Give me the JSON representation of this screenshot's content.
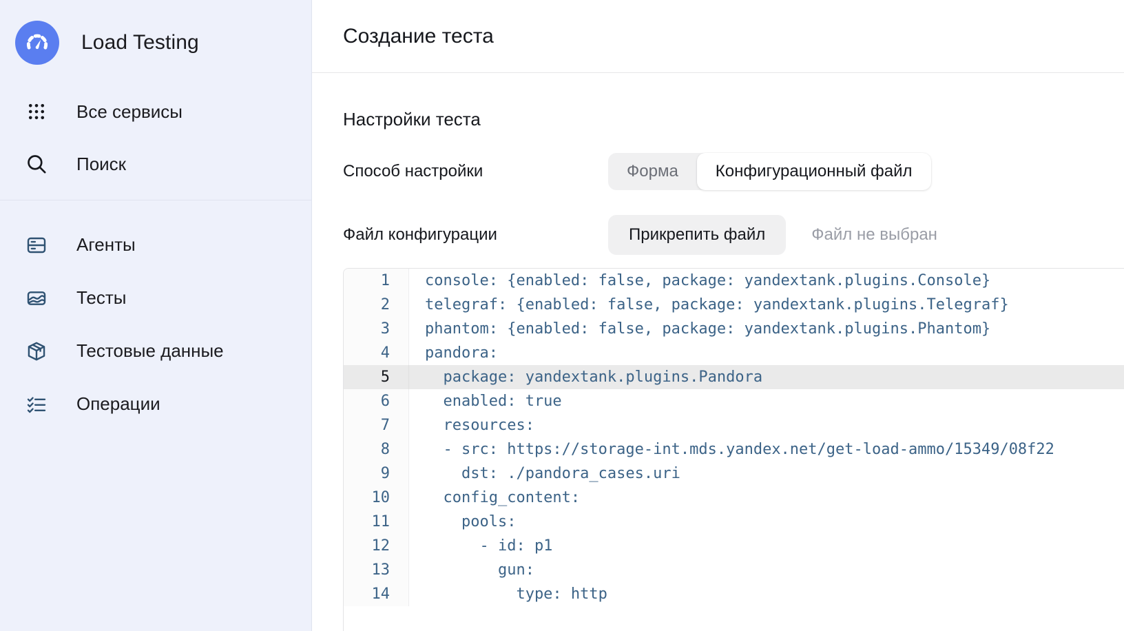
{
  "sidebar": {
    "brand": {
      "title": "Load Testing",
      "logo_icon": "speedometer-icon",
      "logo_color": "#5a7ef0"
    },
    "top_items": [
      {
        "label": "Все сервисы",
        "icon": "grid-dots-icon"
      },
      {
        "label": "Поиск",
        "icon": "search-icon"
      }
    ],
    "bottom_items": [
      {
        "label": "Агенты",
        "icon": "server-icon"
      },
      {
        "label": "Тесты",
        "icon": "chart-area-icon"
      },
      {
        "label": "Тестовые данные",
        "icon": "box-icon"
      },
      {
        "label": "Операции",
        "icon": "checklist-icon"
      }
    ]
  },
  "header": {
    "title": "Создание теста"
  },
  "main": {
    "section_title": "Настройки теста",
    "config_method": {
      "label": "Способ настройки",
      "options": [
        "Форма",
        "Конфигурационный файл"
      ],
      "selected": "Конфигурационный файл"
    },
    "config_file": {
      "label": "Файл конфигурации",
      "attach_button": "Прикрепить файл",
      "status": "Файл не выбран"
    }
  },
  "editor": {
    "active_line": 5,
    "lines": [
      {
        "n": "1",
        "text": "console: {enabled: false, package: yandextank.plugins.Console}"
      },
      {
        "n": "2",
        "text": "telegraf: {enabled: false, package: yandextank.plugins.Telegraf}"
      },
      {
        "n": "3",
        "text": "phantom: {enabled: false, package: yandextank.plugins.Phantom}"
      },
      {
        "n": "4",
        "text": "pandora:"
      },
      {
        "n": "5",
        "text": "  package: yandextank.plugins.Pandora"
      },
      {
        "n": "6",
        "text": "  enabled: true"
      },
      {
        "n": "7",
        "text": "  resources:"
      },
      {
        "n": "8",
        "text": "  - src: https://storage-int.mds.yandex.net/get-load-ammo/15349/08f22"
      },
      {
        "n": "9",
        "text": "    dst: ./pandora_cases.uri"
      },
      {
        "n": "10",
        "text": "  config_content:"
      },
      {
        "n": "11",
        "text": "    pools:"
      },
      {
        "n": "12",
        "text": "      - id: p1"
      },
      {
        "n": "13",
        "text": "        gun:"
      },
      {
        "n": "14",
        "text": "          type: http"
      }
    ]
  }
}
